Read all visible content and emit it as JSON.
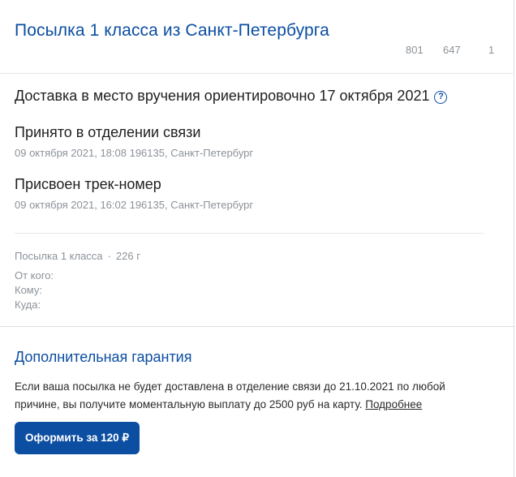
{
  "header": {
    "title": "Посылка 1 класса из Санкт-Петербурга",
    "track_parts": [
      "801",
      "647",
      "1"
    ]
  },
  "delivery_estimate": "Доставка в место вручения ориентировочно 17 октября 2021",
  "help_icon_glyph": "?",
  "events": [
    {
      "title": "Принято в отделении связи",
      "meta": "09 октября 2021, 18:08 196135, Санкт-Петербург"
    },
    {
      "title": "Присвоен трек-номер",
      "meta": "09 октября 2021, 16:02 196135, Санкт-Петербург"
    }
  ],
  "parcel": {
    "type": "Посылка 1 класса",
    "separator": "·",
    "weight": "226 г",
    "from_label": "От кого:",
    "to_label": "Кому:",
    "address_label": "Куда:"
  },
  "guarantee": {
    "title": "Дополнительная гарантия",
    "text": "Если ваша посылка не будет доставлена в отделение связи до 21.10.2021 по любой причине, вы получите моментальную выплату до 2500 руб на карту.",
    "link": "Подробнее",
    "button": "Оформить за 120 ₽"
  },
  "colors": {
    "accent": "#0b4ea2",
    "muted_text": "#8c9299",
    "divider": "#e4e7eb"
  }
}
